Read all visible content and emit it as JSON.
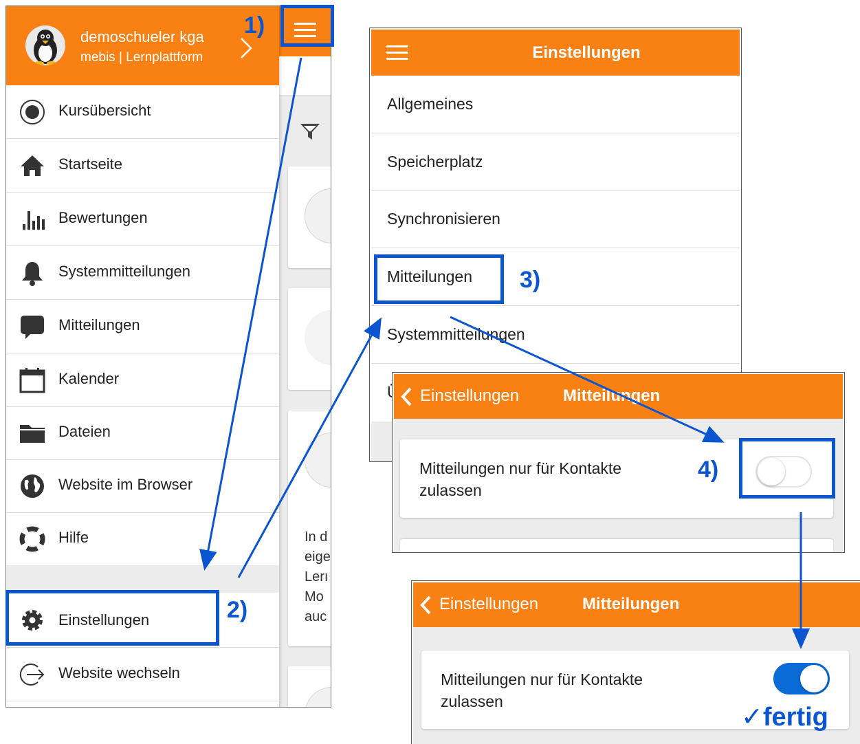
{
  "colors": {
    "accent": "#f98012",
    "annotation": "#0b55d0",
    "toggle_on": "#0a6bd6"
  },
  "panel1": {
    "user": {
      "name": "demoschueler kga",
      "site": "mebis | Lernplattform"
    },
    "menu": [
      {
        "label": "Kursübersicht",
        "icon": "course-overview-icon"
      },
      {
        "label": "Startseite",
        "icon": "home-icon"
      },
      {
        "label": "Bewertungen",
        "icon": "grades-icon"
      },
      {
        "label": "Systemmitteilungen",
        "icon": "bell-icon"
      },
      {
        "label": "Mitteilungen",
        "icon": "chat-icon"
      },
      {
        "label": "Kalender",
        "icon": "calendar-icon"
      },
      {
        "label": "Dateien",
        "icon": "folder-icon"
      },
      {
        "label": "Website im Browser",
        "icon": "globe-icon"
      },
      {
        "label": "Hilfe",
        "icon": "lifebuoy-icon"
      }
    ],
    "settings_item": {
      "label": "Einstellungen",
      "icon": "gear-icon"
    },
    "switch_site_item": {
      "label": "Website wechseln",
      "icon": "sign-out-icon"
    },
    "background_text": [
      "In d",
      "eige",
      "Lerı",
      "Mo",
      "auc"
    ]
  },
  "panel2": {
    "title": "Einstellungen",
    "items": [
      "Allgemeines",
      "Speicherplatz",
      "Synchronisieren",
      "Mitteilungen",
      "Systemmitteilungen",
      "Ü"
    ]
  },
  "panel3": {
    "back_label": "Einstellungen",
    "title": "Mitteilungen",
    "option_label": "Mitteilungen nur für Kontakte zulassen",
    "toggle_on": false
  },
  "panel4": {
    "back_label": "Einstellungen",
    "title": "Mitteilungen",
    "option_label": "Mitteilungen nur für Kontakte zulassen",
    "toggle_on": true
  },
  "annotations": {
    "step1": "1)",
    "step2": "2)",
    "step3": "3)",
    "step4": "4)",
    "done": "✓fertig"
  }
}
